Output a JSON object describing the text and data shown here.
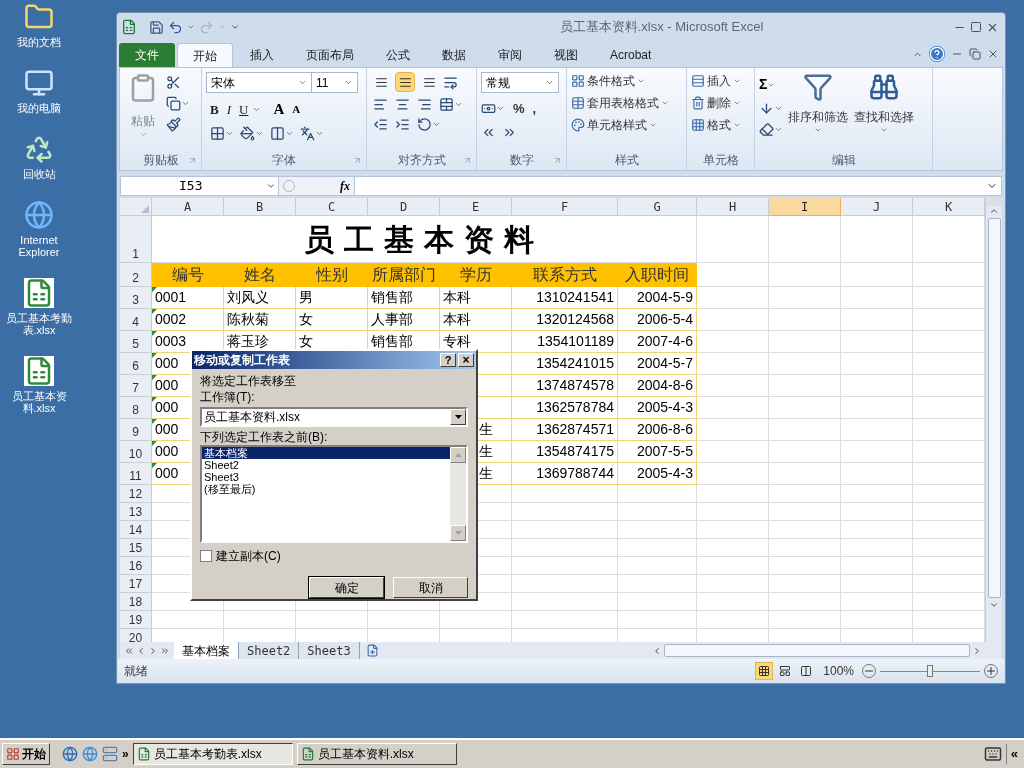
{
  "desktop_icons": [
    {
      "kind": "documents",
      "label": "我的文档"
    },
    {
      "kind": "computer",
      "label": "我的电脑"
    },
    {
      "kind": "recycle",
      "label": "回收站"
    },
    {
      "kind": "browser",
      "label": "Internet Explorer"
    },
    {
      "kind": "excel",
      "label": "员工基本考勤表.xlsx"
    },
    {
      "kind": "excel",
      "label": "员工基本资料.xlsx"
    }
  ],
  "window": {
    "title": "员工基本资料.xlsx - Microsoft Excel"
  },
  "ribbon_tabs": [
    {
      "label": "文件",
      "kind": "file",
      "selected": false
    },
    {
      "label": "开始",
      "kind": "tab",
      "selected": true
    },
    {
      "label": "插入",
      "kind": "tab",
      "selected": false
    },
    {
      "label": "页面布局",
      "kind": "tab",
      "selected": false
    },
    {
      "label": "公式",
      "kind": "tab",
      "selected": false
    },
    {
      "label": "数据",
      "kind": "tab",
      "selected": false
    },
    {
      "label": "审阅",
      "kind": "tab",
      "selected": false
    },
    {
      "label": "视图",
      "kind": "tab",
      "selected": false
    },
    {
      "label": "Acrobat",
      "kind": "tab",
      "selected": false
    }
  ],
  "ribbon_groups": [
    {
      "kind": "clipboard",
      "label": "剪贴板",
      "launcher": true,
      "paste": "粘贴"
    },
    {
      "kind": "font",
      "label": "字体",
      "launcher": true,
      "font": "宋体",
      "size": "11",
      "buttons": [
        "B",
        "I",
        "U"
      ],
      "grow": "A",
      "shrink": "A"
    },
    {
      "kind": "alignment",
      "label": "对齐方式",
      "launcher": true,
      "valign": [
        {
          "selected": false
        },
        {
          "selected": true
        },
        {
          "selected": false
        }
      ]
    },
    {
      "kind": "number",
      "label": "数字",
      "launcher": true,
      "format": "常规",
      "symbols": [
        "%",
        ","
      ]
    },
    {
      "kind": "styles",
      "label": "样式",
      "launcher": false,
      "items": [
        "条件格式",
        "套用表格格式",
        "单元格样式"
      ]
    },
    {
      "kind": "cells",
      "label": "单元格",
      "launcher": false,
      "items": [
        "插入",
        "删除",
        "格式"
      ]
    },
    {
      "kind": "editing",
      "label": "编辑",
      "launcher": false,
      "sum": "Σ",
      "items": [
        "排序和筛选",
        "查找和选择"
      ]
    }
  ],
  "formula_bar": {
    "name_box": "I53",
    "fx": "fx"
  },
  "columns": [
    {
      "label": "A",
      "selected": false
    },
    {
      "label": "B",
      "selected": false
    },
    {
      "label": "C",
      "selected": false
    },
    {
      "label": "D",
      "selected": false
    },
    {
      "label": "E",
      "selected": false
    },
    {
      "label": "F",
      "selected": false
    },
    {
      "label": "G",
      "selected": false
    },
    {
      "label": "H",
      "selected": false
    },
    {
      "label": "I",
      "selected": true
    },
    {
      "label": "J",
      "selected": false
    },
    {
      "label": "K",
      "selected": false
    }
  ],
  "rows": [
    {
      "num": "1",
      "kind": "title",
      "text": "员工基本资料"
    },
    {
      "num": "2",
      "kind": "header",
      "cells": [
        "编号",
        "姓名",
        "性别",
        "所属部门",
        "学历",
        "联系方式",
        "入职时间"
      ]
    },
    {
      "num": "3",
      "kind": "data",
      "flag": true,
      "cells": [
        "0001",
        "刘风义",
        "男",
        "销售部",
        "本科",
        "1310241541",
        "2004-5-9"
      ]
    },
    {
      "num": "4",
      "kind": "data",
      "flag": true,
      "cells": [
        "0002",
        "陈秋菊",
        "女",
        "人事部",
        "本科",
        "1320124568",
        "2006-5-4"
      ]
    },
    {
      "num": "5",
      "kind": "data",
      "flag": true,
      "cells": [
        "0003",
        "蒋玉珍",
        "女",
        "销售部",
        "专科",
        "1354101189",
        "2007-4-6"
      ]
    },
    {
      "num": "6",
      "kind": "data",
      "flag": true,
      "cells": [
        "000",
        null,
        null,
        null,
        null,
        "1354241015",
        "2004-5-7"
      ]
    },
    {
      "num": "7",
      "kind": "data",
      "flag": true,
      "cells": [
        "000",
        null,
        null,
        null,
        null,
        "1374874578",
        "2004-8-6"
      ]
    },
    {
      "num": "8",
      "kind": "data",
      "flag": true,
      "cells": [
        "000",
        null,
        null,
        null,
        null,
        "1362578784",
        "2005-4-3"
      ]
    },
    {
      "num": "9",
      "kind": "data",
      "flag": true,
      "cells": [
        "000",
        null,
        null,
        null,
        "生",
        "1362874571",
        "2006-8-6"
      ]
    },
    {
      "num": "10",
      "kind": "data",
      "flag": true,
      "cells": [
        "000",
        null,
        null,
        null,
        "生",
        "1354874175",
        "2007-5-5"
      ]
    },
    {
      "num": "11",
      "kind": "data",
      "flag": true,
      "cells": [
        "000",
        null,
        null,
        null,
        "生",
        "1369788744",
        "2005-4-3"
      ]
    },
    {
      "num": "12",
      "kind": "empty"
    },
    {
      "num": "13",
      "kind": "empty"
    },
    {
      "num": "14",
      "kind": "empty"
    },
    {
      "num": "15",
      "kind": "empty"
    },
    {
      "num": "16",
      "kind": "empty"
    },
    {
      "num": "17",
      "kind": "empty"
    },
    {
      "num": "18",
      "kind": "empty"
    },
    {
      "num": "19",
      "kind": "empty"
    },
    {
      "num": "20",
      "kind": "empty"
    }
  ],
  "sheet_tabs": [
    {
      "label": "基本档案",
      "selected": true
    },
    {
      "label": "Sheet2",
      "selected": false
    },
    {
      "label": "Sheet3",
      "selected": false
    }
  ],
  "status_bar": {
    "text": "就绪",
    "views": [
      {
        "selected": true
      },
      {
        "selected": false
      },
      {
        "selected": false
      }
    ],
    "zoom": "100%",
    "level": 0.5
  },
  "dialog": {
    "title": "移动或复制工作表",
    "help": "?",
    "close": "×",
    "prompt": "将选定工作表移至",
    "workbook_label": "工作簿(T):",
    "workbook": "员工基本资料.xlsx",
    "before_label": "下列选定工作表之前(B):",
    "sheets": [
      {
        "label": "基本档案",
        "selected": true
      },
      {
        "label": "Sheet2",
        "selected": false
      },
      {
        "label": "Sheet3",
        "selected": false
      },
      {
        "label": "(移至最后)",
        "selected": false
      }
    ],
    "copy": {
      "label": "建立副本(C)",
      "checked": false
    },
    "buttons": [
      "确定",
      "取消"
    ]
  },
  "taskbar": {
    "start": "开始",
    "more": "»",
    "tasks": [
      {
        "label": "员工基本考勤表.xlsx",
        "selected": true
      },
      {
        "label": "员工基本资料.xlsx",
        "selected": false
      }
    ],
    "tray_more": "«"
  }
}
